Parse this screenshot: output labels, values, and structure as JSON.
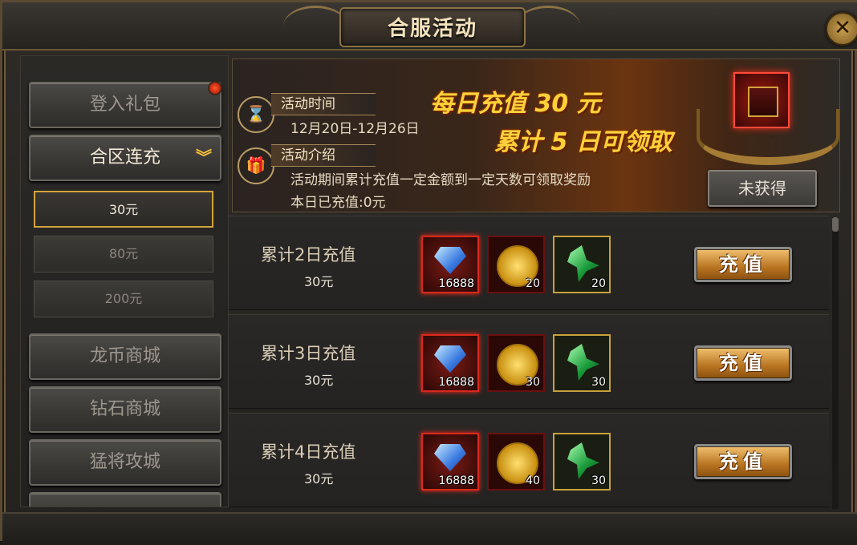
{
  "window": {
    "title": "合服活动"
  },
  "sidebar": {
    "items": [
      {
        "label": "登入礼包"
      },
      {
        "label": "合区连充"
      },
      {
        "label": "龙币商城"
      },
      {
        "label": "钻石商城"
      },
      {
        "label": "猛将攻城"
      }
    ],
    "sub_items": [
      {
        "label": "30元"
      },
      {
        "label": "80元"
      },
      {
        "label": "200元"
      }
    ]
  },
  "banner": {
    "time_label": "活动时间",
    "time_value": "12月20日-12月26日",
    "intro_label": "活动介绍",
    "intro_text": "活动期间累计充值一定金额到一定天数可领取奖励",
    "today_text": "本日已充值:0元",
    "promo_line1": "每日充值  30  元",
    "promo_line2": "累计  5  日可领取",
    "status_button": "未获得"
  },
  "rows": [
    {
      "title": "累计2日充值",
      "amount": "30元",
      "items": [
        {
          "qty": "16888"
        },
        {
          "qty": "20"
        },
        {
          "qty": "20"
        }
      ],
      "button": "充值"
    },
    {
      "title": "累计3日充值",
      "amount": "30元",
      "items": [
        {
          "qty": "16888"
        },
        {
          "qty": "30"
        },
        {
          "qty": "30"
        }
      ],
      "button": "充值"
    },
    {
      "title": "累计4日充值",
      "amount": "30元",
      "items": [
        {
          "qty": "16888"
        },
        {
          "qty": "40"
        },
        {
          "qty": "30"
        }
      ],
      "button": "充值"
    }
  ],
  "icons": {
    "time": "hourglass-icon",
    "intro": "gift-icon",
    "close": "close-icon"
  }
}
